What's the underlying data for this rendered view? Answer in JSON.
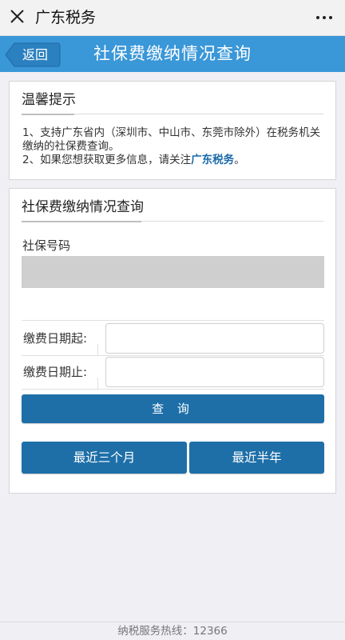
{
  "wechat_bar": {
    "title": "广东税务"
  },
  "header": {
    "back_label": "返回",
    "title": "社保费缴纳情况查询"
  },
  "tips": {
    "title": "温馨提示",
    "line1": "1、支持广东省内（深圳市、中山市、东莞市除外）在税务机关缴纳的社保费查询。",
    "line2_prefix": "2、如果您想获取更多信息，请关注",
    "line2_link": "广东税务",
    "line2_suffix": "。"
  },
  "query": {
    "title": "社保费缴纳情况查询",
    "ssn_label": "社保号码",
    "ssn_value": "",
    "start_date_label": "缴费日期起:",
    "start_date_value": "",
    "end_date_label": "缴费日期止:",
    "end_date_value": "",
    "query_button": "查 询",
    "last_three_months_button": "最近三个月",
    "last_half_year_button": "最近半年"
  },
  "footer": {
    "hotline": "纳税服务热线：12366"
  },
  "colors": {
    "header_bg": "#3a97d8",
    "button_bg": "#1e6fa8",
    "link": "#1a6aab"
  }
}
